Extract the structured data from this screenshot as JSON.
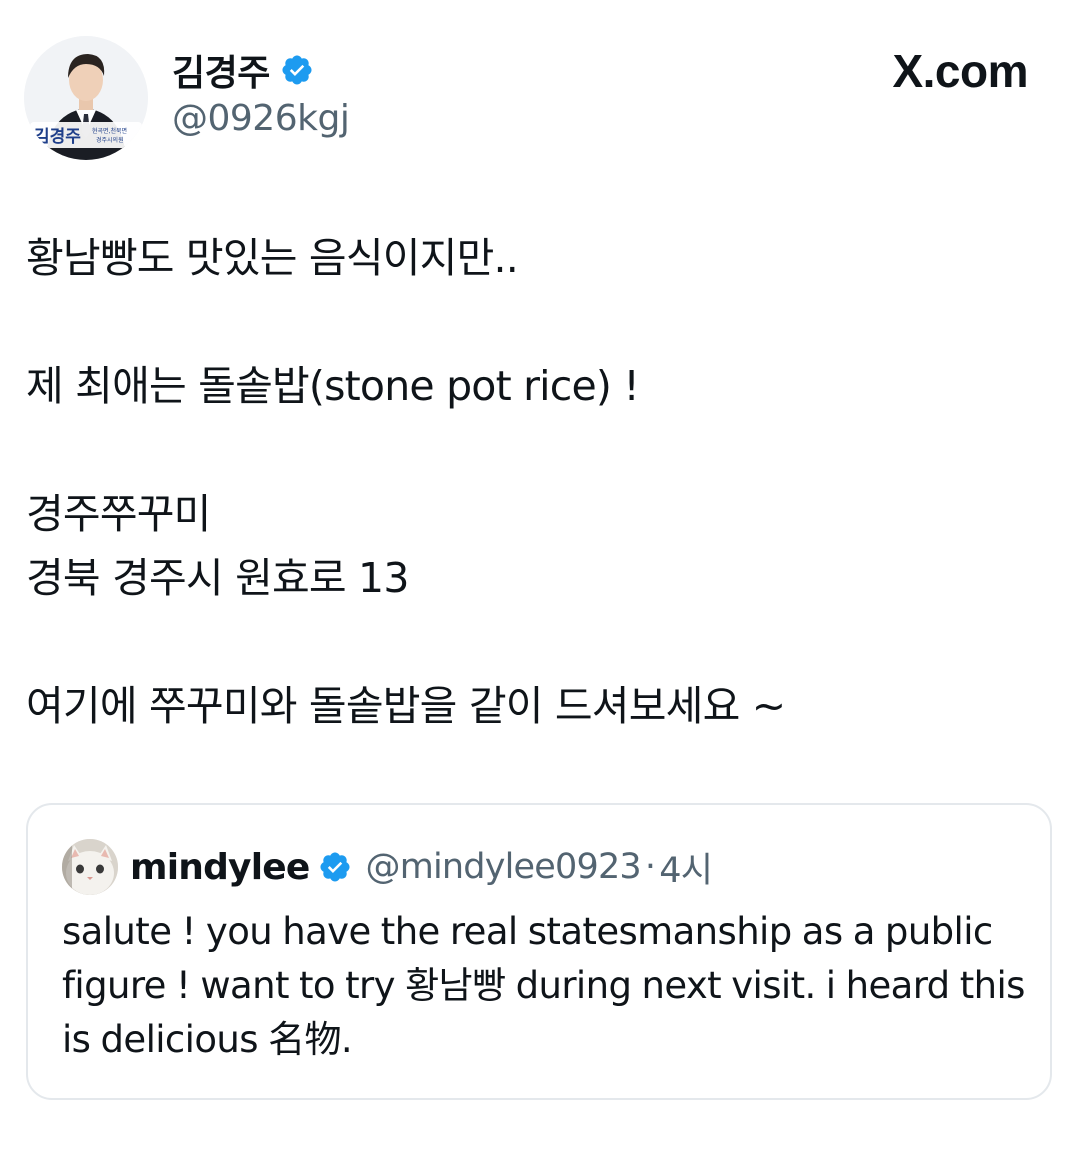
{
  "header": {
    "display_name": "김경주",
    "handle": "@0926kgj",
    "brand": "X.com",
    "avatar_banner_name": "김경주",
    "avatar_banner_sub1": "현곡면,천북면",
    "avatar_banner_sub2": "경주시의원"
  },
  "tweet": {
    "lines": [
      "황남빵도 맛있는 음식이지만..",
      "제 최애는 돌솥밥(stone pot rice) !",
      "경주쭈꾸미",
      "경북 경주시 원효로 13",
      "여기에 쭈꾸미와 돌솥밥을 같이 드셔보세요 ~"
    ]
  },
  "quoted": {
    "name": "mindylee",
    "handle": "@mindylee0923",
    "separator": "·",
    "time": "4시",
    "text": "salute ! you have the real statesmanship as a public figure ! want to try 황남빵 during next visit. i heard this is delicious 名物."
  },
  "colors": {
    "verified": "#1d9bf0",
    "text": "#0f1419",
    "secondary": "#536471",
    "border": "#e4e8ec",
    "avatar_banner": "#1f3f8a"
  },
  "icons": {
    "verified": "verified-badge-icon",
    "avatar": "profile-photo",
    "quote_avatar": "cat-profile-photo"
  }
}
